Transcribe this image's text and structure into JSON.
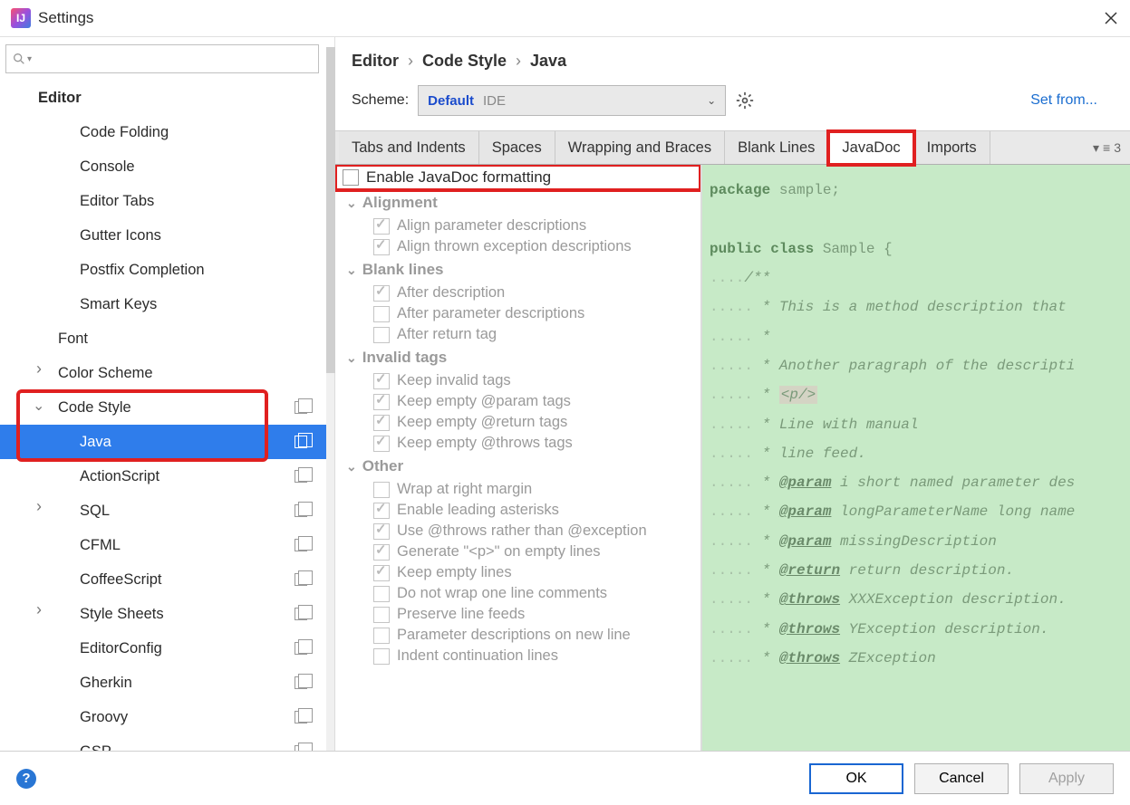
{
  "window": {
    "title": "Settings"
  },
  "sidebar": {
    "items": [
      {
        "label": "Editor",
        "indent": 1,
        "bold": true
      },
      {
        "label": "Code Folding",
        "indent": 3
      },
      {
        "label": "Console",
        "indent": 3
      },
      {
        "label": "Editor Tabs",
        "indent": 3
      },
      {
        "label": "Gutter Icons",
        "indent": 3
      },
      {
        "label": "Postfix Completion",
        "indent": 3
      },
      {
        "label": "Smart Keys",
        "indent": 3
      },
      {
        "label": "Font",
        "indent": 2
      },
      {
        "label": "Color Scheme",
        "indent": 2,
        "arrow": "collapsed"
      },
      {
        "label": "Code Style",
        "indent": 2,
        "arrow": "expanded",
        "copy": true
      },
      {
        "label": "Java",
        "indent": 3,
        "selected": true,
        "copy": true
      },
      {
        "label": "ActionScript",
        "indent": 3,
        "copy": true
      },
      {
        "label": "SQL",
        "indent": 3,
        "arrow": "collapsed",
        "copy": true
      },
      {
        "label": "CFML",
        "indent": 3,
        "copy": true
      },
      {
        "label": "CoffeeScript",
        "indent": 3,
        "copy": true
      },
      {
        "label": "Style Sheets",
        "indent": 3,
        "arrow": "collapsed",
        "copy": true
      },
      {
        "label": "EditorConfig",
        "indent": 3,
        "copy": true
      },
      {
        "label": "Gherkin",
        "indent": 3,
        "copy": true
      },
      {
        "label": "Groovy",
        "indent": 3,
        "copy": true
      },
      {
        "label": "GSP",
        "indent": 3,
        "copy": true
      }
    ]
  },
  "breadcrumb": {
    "a": "Editor",
    "b": "Code Style",
    "c": "Java"
  },
  "scheme": {
    "label": "Scheme:",
    "name": "Default",
    "ide": "IDE",
    "setfrom": "Set from..."
  },
  "tabs": [
    {
      "label": "Tabs and Indents"
    },
    {
      "label": "Spaces"
    },
    {
      "label": "Wrapping and Braces"
    },
    {
      "label": "Blank Lines"
    },
    {
      "label": "JavaDoc",
      "active": true,
      "highlight": true
    },
    {
      "label": "Imports"
    }
  ],
  "tabsmore": "3",
  "enable": {
    "label": "Enable JavaDoc formatting",
    "checked": false
  },
  "sections": [
    {
      "title": "Alignment",
      "opts": [
        {
          "label": "Align parameter descriptions",
          "checked": true
        },
        {
          "label": "Align thrown exception descriptions",
          "checked": true
        }
      ]
    },
    {
      "title": "Blank lines",
      "opts": [
        {
          "label": "After description",
          "checked": true
        },
        {
          "label": "After parameter descriptions",
          "checked": false
        },
        {
          "label": "After return tag",
          "checked": false
        }
      ]
    },
    {
      "title": "Invalid tags",
      "opts": [
        {
          "label": "Keep invalid tags",
          "checked": true
        },
        {
          "label": "Keep empty @param tags",
          "checked": true
        },
        {
          "label": "Keep empty @return tags",
          "checked": true
        },
        {
          "label": "Keep empty @throws tags",
          "checked": true
        }
      ]
    },
    {
      "title": "Other",
      "opts": [
        {
          "label": "Wrap at right margin",
          "checked": false
        },
        {
          "label": "Enable leading asterisks",
          "checked": true
        },
        {
          "label": "Use @throws rather than @exception",
          "checked": true
        },
        {
          "label": "Generate \"<p>\" on empty lines",
          "checked": true
        },
        {
          "label": "Keep empty lines",
          "checked": true
        },
        {
          "label": "Do not wrap one line comments",
          "checked": false
        },
        {
          "label": "Preserve line feeds",
          "checked": false
        },
        {
          "label": "Parameter descriptions on new line",
          "checked": false
        },
        {
          "label": "Indent continuation lines",
          "checked": false
        }
      ]
    }
  ],
  "code": {
    "l1": "package",
    "l1b": " sample;",
    "l2": "public class",
    "l2b": " Sample {",
    "c1": "/**",
    "c2": " * This is a method description that ",
    "c3": " *",
    "c4": " * Another paragraph of the descripti",
    "c5a": " * ",
    "c5b": "<p/>",
    "c6": " * Line with manual",
    "c7": " * line feed.",
    "p1a": " * ",
    "p1t": "@param",
    "p1b": " i short named parameter des",
    "p2a": " * ",
    "p2t": "@param",
    "p2b": " longParameterName long name",
    "p3a": " * ",
    "p3t": "@param",
    "p3b": " missingDescription",
    "r1a": " * ",
    "r1t": "@return",
    "r1b": " return description.",
    "t1a": " * ",
    "t1t": "@throws",
    "t1b": " XXXException description.",
    "t2a": " * ",
    "t2t": "@throws",
    "t2b": " YException description.",
    "t3a": " * ",
    "t3t": "@throws",
    "t3b": " ZException"
  },
  "footer": {
    "ok": "OK",
    "cancel": "Cancel",
    "apply": "Apply"
  }
}
